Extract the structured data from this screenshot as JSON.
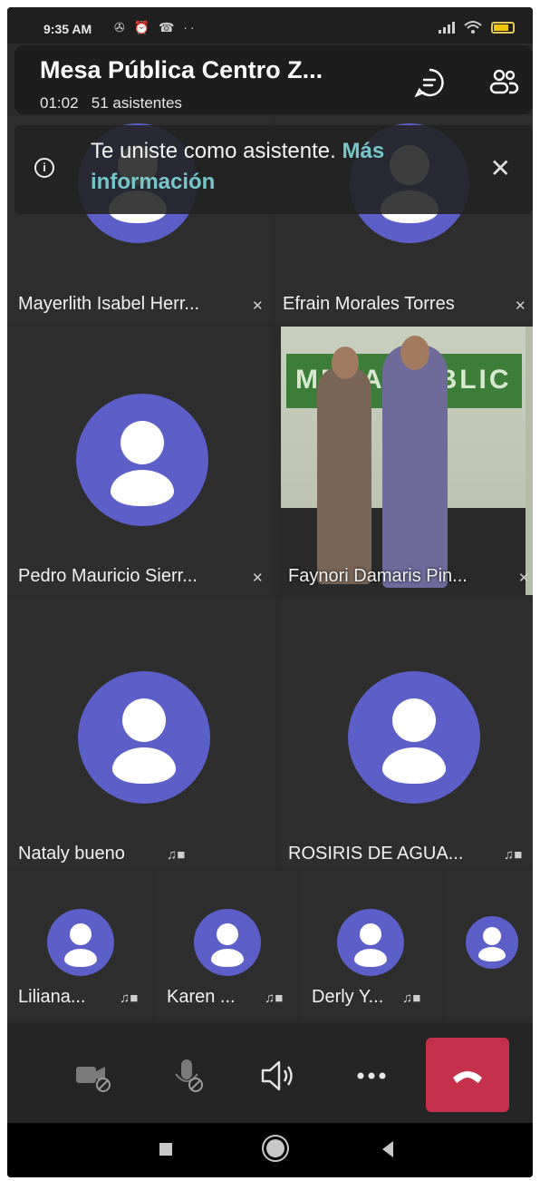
{
  "status_bar": {
    "time": "9:35 AM",
    "left_icons": "✇ ⏰ ☎ ··",
    "battery_color": "#f1c40f"
  },
  "header": {
    "title": "Mesa Pública Centro Z...",
    "duration": "01:02",
    "attendees": "51 asistentes",
    "chat_icon": "chat-icon",
    "people_icon": "people-icon"
  },
  "banner": {
    "text": "Te uniste como asistente.",
    "link": "Más información",
    "close_icon": "close-icon",
    "info_icon": "info-icon"
  },
  "participants_large": [
    {
      "name": "Mayerlith Isabel Herr...",
      "status": "muted"
    },
    {
      "name": "Efrain Morales Torres",
      "status": "muted"
    },
    {
      "name": "Pedro Mauricio Sierr...",
      "status": "muted"
    },
    {
      "name": "Faynori Damaris Pin...",
      "status": "muted",
      "video": true
    },
    {
      "name": "Nataly bueno",
      "status": "mic-camera"
    },
    {
      "name": "ROSIRIS DE AGUA...",
      "status": "mic-camera"
    }
  ],
  "participants_small": [
    {
      "name": "Liliana..."
    },
    {
      "name": "Karen ..."
    },
    {
      "name": "Derly Y..."
    },
    {
      "name": ""
    }
  ],
  "video_banner_text": "MESA PÚBLIC",
  "controls": {
    "camera": "camera-off-icon",
    "mic": "mic-off-icon",
    "speaker": "speaker-icon",
    "more": "more-options-icon",
    "hangup": "hang-up-icon"
  },
  "colors": {
    "accent": "#5b5fc7",
    "hangup": "#c4314b",
    "link": "#77c6c9"
  }
}
